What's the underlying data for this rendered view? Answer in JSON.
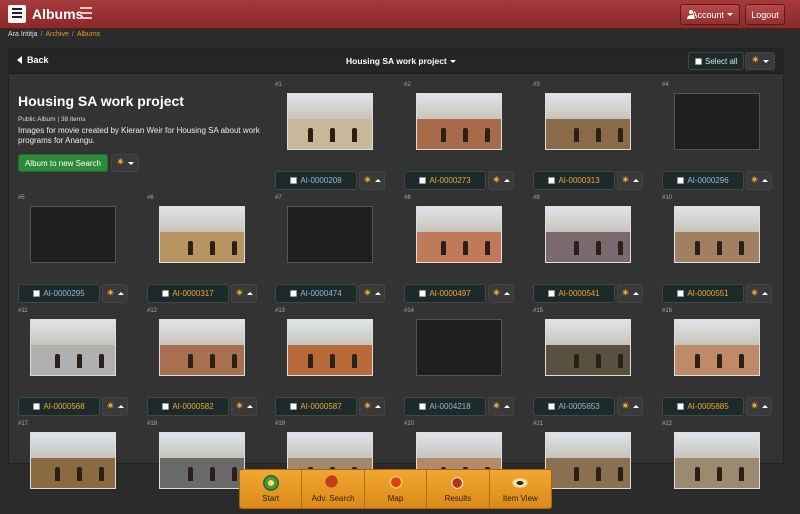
{
  "topbar": {
    "app_title": "Albums",
    "account_label": "Account",
    "logout_label": "Logout"
  },
  "breadcrumb": {
    "items": [
      "Ara Irititja",
      "Archive",
      "Albums"
    ]
  },
  "panel": {
    "back_label": "Back",
    "album_menu_label": "Housing SA work project",
    "select_all_label": "Select all"
  },
  "album": {
    "title": "Housing SA work project",
    "meta": "Public Album | 38 items",
    "description": "Images for movie created by Kieran Weir for Housing SA about work programs for Anangu.",
    "new_search_label": "Album to new Search"
  },
  "items": [
    {
      "num": "#1",
      "id": "AI-0000208",
      "color": "blue",
      "photo": "#c9b79a"
    },
    {
      "num": "#2",
      "id": "AI-0000273",
      "color": "orange",
      "photo": "#a86a48"
    },
    {
      "num": "#3",
      "id": "AI-0000313",
      "color": "orange",
      "photo": "#8a6a48"
    },
    {
      "num": "#4",
      "id": "AI-0000296",
      "color": "blue",
      "photo": null
    },
    {
      "num": "#5",
      "id": "AI-0000295",
      "color": "blue",
      "photo": null
    },
    {
      "num": "#6",
      "id": "AI-0000317",
      "color": "orange",
      "photo": "#b89560"
    },
    {
      "num": "#7",
      "id": "AI-0000474",
      "color": "blue",
      "photo": null
    },
    {
      "num": "#8",
      "id": "AI-0000497",
      "color": "orange",
      "photo": "#c07a5a"
    },
    {
      "num": "#9",
      "id": "AI-0000541",
      "color": "orange",
      "photo": "#7a6a70"
    },
    {
      "num": "#10",
      "id": "AI-0000551",
      "color": "orange",
      "photo": "#a08060"
    },
    {
      "num": "#11",
      "id": "AI-0000568",
      "color": "orange",
      "photo": "#b0b0b0"
    },
    {
      "num": "#12",
      "id": "AI-0000582",
      "color": "orange",
      "photo": "#a87050"
    },
    {
      "num": "#13",
      "id": "AI-0000587",
      "color": "orange",
      "photo": "#b86a3a"
    },
    {
      "num": "#14",
      "id": "AI-0004218",
      "color": "blue",
      "photo": null
    },
    {
      "num": "#15",
      "id": "AI-0005653",
      "color": "blue",
      "photo": "#5a5040"
    },
    {
      "num": "#16",
      "id": "AI-0005885",
      "color": "orange",
      "photo": "#c08a68"
    },
    {
      "num": "#17",
      "id": "",
      "color": "blue",
      "photo": "#8a6a40"
    },
    {
      "num": "#18",
      "id": "",
      "color": "blue",
      "photo": "#6a6a6a"
    },
    {
      "num": "#19",
      "id": "",
      "color": "blue",
      "photo": "#a08870"
    },
    {
      "num": "#20",
      "id": "",
      "color": "blue",
      "photo": "#b08a6a"
    },
    {
      "num": "#21",
      "id": "",
      "color": "blue",
      "photo": "#8a7050"
    },
    {
      "num": "#22",
      "id": "",
      "color": "blue",
      "photo": "#9a8a70"
    }
  ],
  "bottom_nav": [
    {
      "label": "Start",
      "icon": "start-icon"
    },
    {
      "label": "Adv. Search",
      "icon": "adv-search-icon"
    },
    {
      "label": "Map",
      "icon": "map-icon"
    },
    {
      "label": "Results",
      "icon": "results-icon"
    },
    {
      "label": "Item View",
      "icon": "item-view-icon"
    }
  ],
  "colors": {
    "topbar": "#9b3233",
    "accent_orange": "#e59a2b",
    "id_blue": "#8fb7d8",
    "green_button": "#2d8a3a"
  }
}
